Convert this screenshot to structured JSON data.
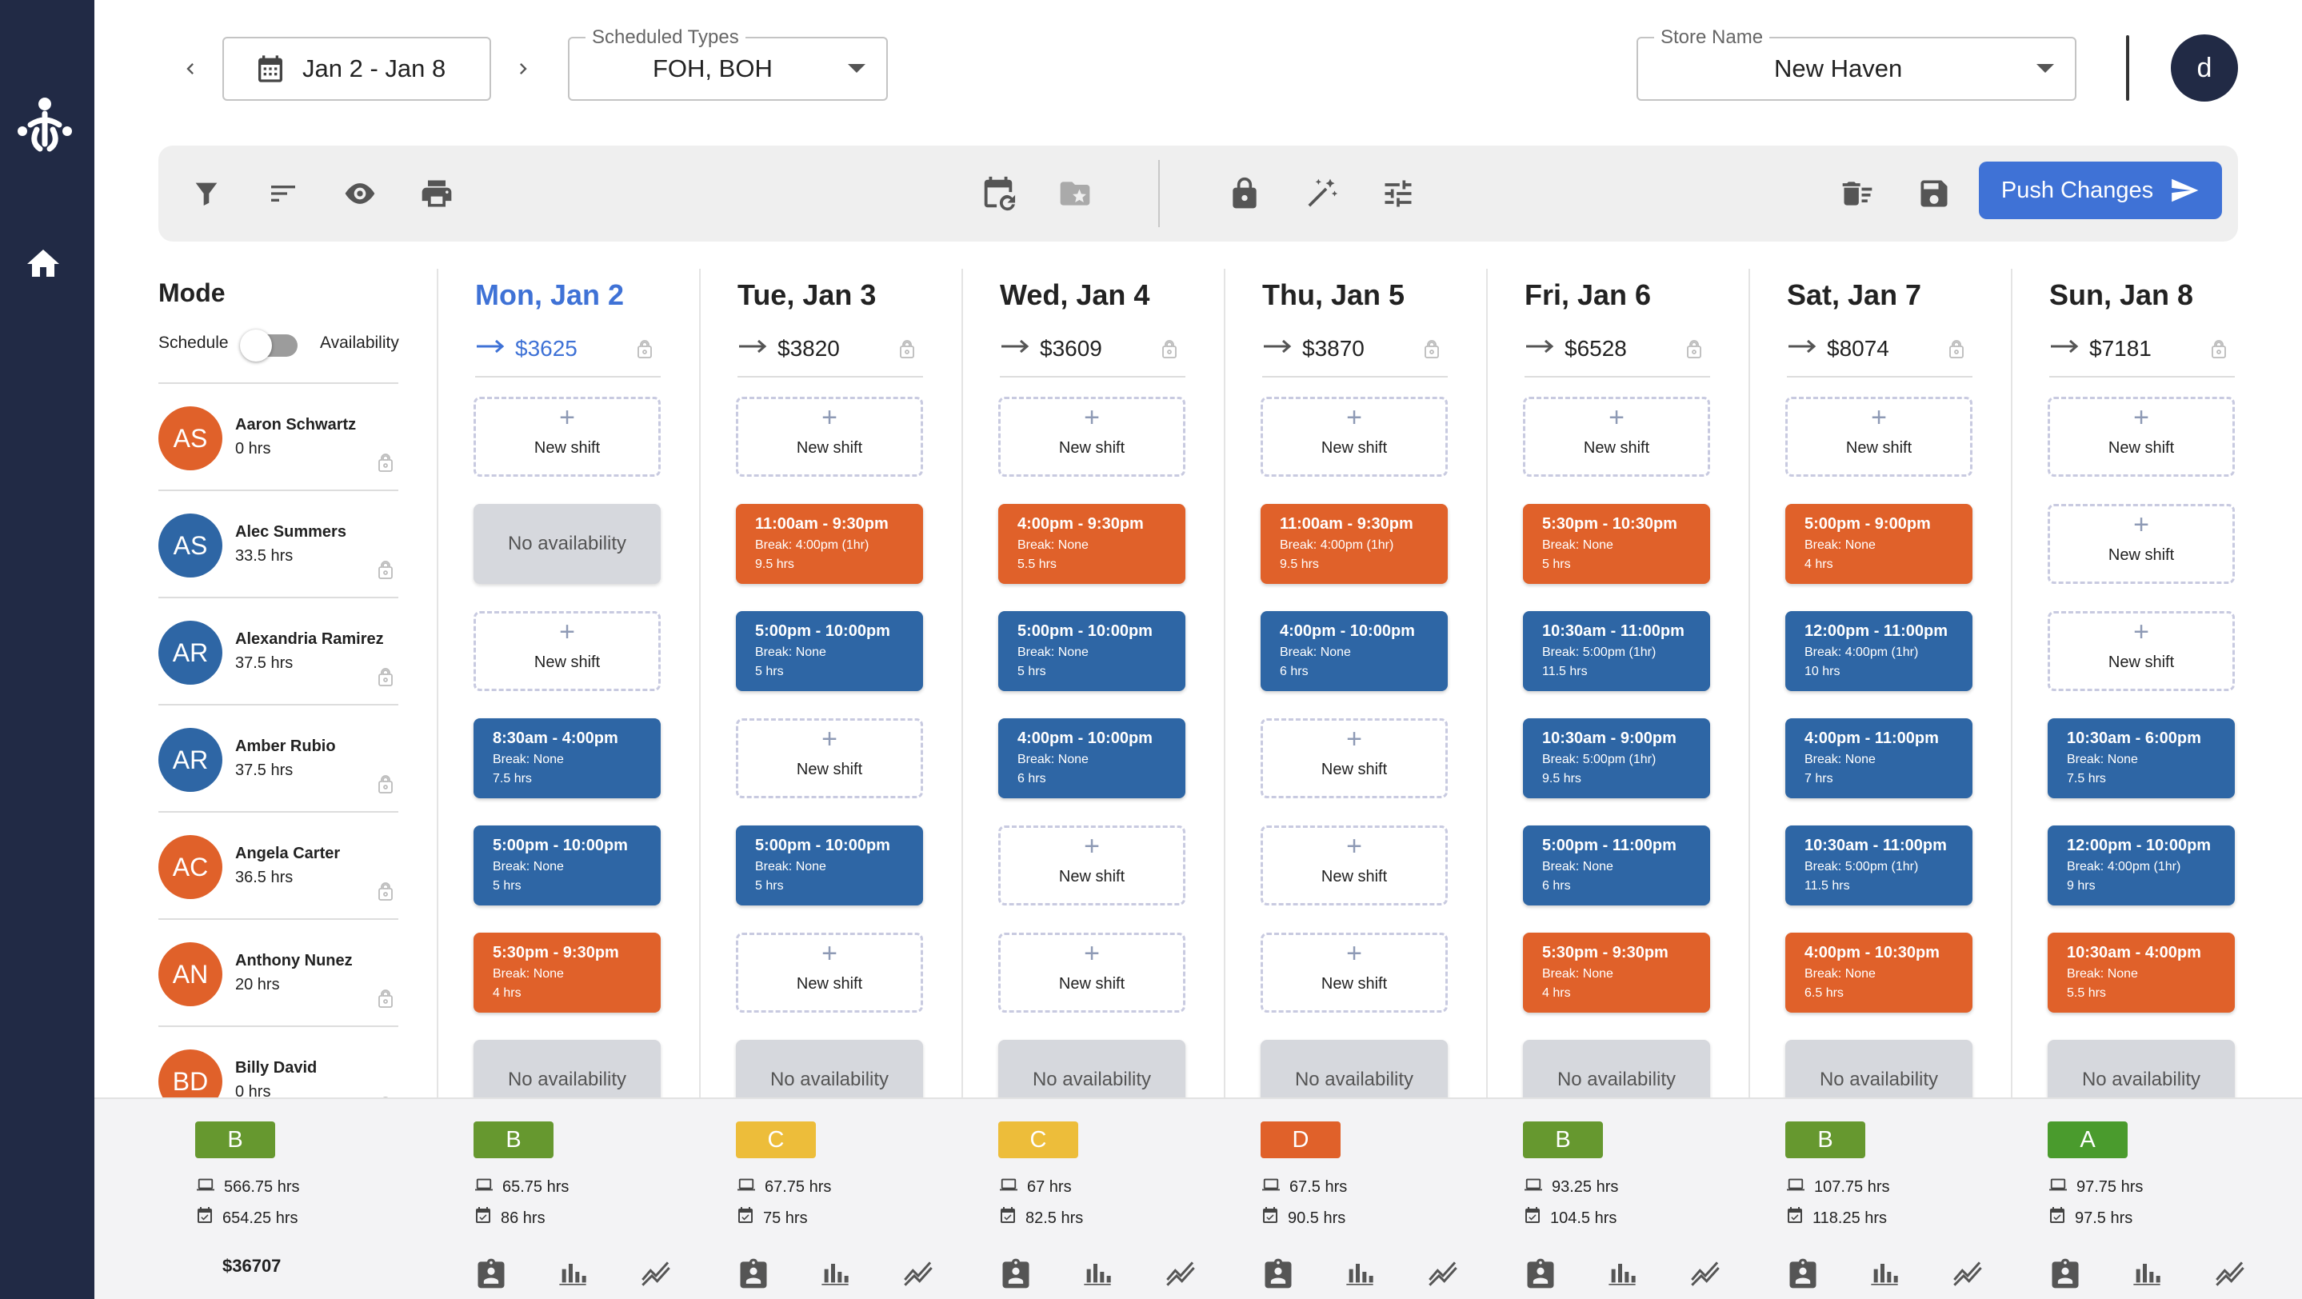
{
  "header": {
    "date_range": "Jan 2 - Jan 8",
    "types_label": "Scheduled Types",
    "types_value": "FOH, BOH",
    "store_label": "Store Name",
    "store_value": "New Haven",
    "user_initial": "d"
  },
  "toolbar": {
    "push_label": "Push Changes"
  },
  "mode": {
    "title": "Mode",
    "left": "Schedule",
    "right": "Availability",
    "availability_on": false
  },
  "labels": {
    "new_shift": "New shift",
    "no_availability": "No availability"
  },
  "colors": {
    "blue": "#2e66a5",
    "orange": "#e0612a",
    "grade_A": "#4a9b2d",
    "grade_B": "#66982f",
    "grade_C": "#edbd3a",
    "grade_D": "#e0612a",
    "accent": "#3f72d6",
    "sidebar": "#212a45"
  },
  "employees": [
    {
      "initials": "AS",
      "name": "Aaron Schwartz",
      "hours": "0 hrs",
      "color": "orange"
    },
    {
      "initials": "AS",
      "name": "Alec Summers",
      "hours": "33.5 hrs",
      "color": "blue"
    },
    {
      "initials": "AR",
      "name": "Alexandria Ramirez",
      "hours": "37.5 hrs",
      "color": "blue"
    },
    {
      "initials": "AR",
      "name": "Amber Rubio",
      "hours": "37.5 hrs",
      "color": "blue"
    },
    {
      "initials": "AC",
      "name": "Angela Carter",
      "hours": "36.5 hrs",
      "color": "orange"
    },
    {
      "initials": "AN",
      "name": "Anthony Nunez",
      "hours": "20 hrs",
      "color": "orange"
    },
    {
      "initials": "BD",
      "name": "Billy David",
      "hours": "0 hrs",
      "color": "orange"
    }
  ],
  "days": [
    {
      "label": "Mon, Jan 2",
      "revenue": "$3625",
      "today": true,
      "cells": [
        {
          "type": "new"
        },
        {
          "type": "na"
        },
        {
          "type": "new"
        },
        {
          "type": "shift",
          "color": "blue",
          "time": "8:30am - 4:00pm",
          "break": "Break: None",
          "hrs": "7.5 hrs"
        },
        {
          "type": "shift",
          "color": "blue",
          "time": "5:00pm - 10:00pm",
          "break": "Break: None",
          "hrs": "5 hrs"
        },
        {
          "type": "shift",
          "color": "orange",
          "time": "5:30pm - 9:30pm",
          "break": "Break: None",
          "hrs": "4 hrs"
        },
        {
          "type": "na"
        }
      ],
      "grade": "B",
      "scheduled": "65.75 hrs",
      "target": "86 hrs"
    },
    {
      "label": "Tue, Jan 3",
      "revenue": "$3820",
      "cells": [
        {
          "type": "new"
        },
        {
          "type": "shift",
          "color": "orange",
          "time": "11:00am - 9:30pm",
          "break": "Break: 4:00pm (1hr)",
          "hrs": "9.5 hrs"
        },
        {
          "type": "shift",
          "color": "blue",
          "time": "5:00pm - 10:00pm",
          "break": "Break: None",
          "hrs": "5 hrs"
        },
        {
          "type": "new"
        },
        {
          "type": "shift",
          "color": "blue",
          "time": "5:00pm - 10:00pm",
          "break": "Break: None",
          "hrs": "5 hrs"
        },
        {
          "type": "new"
        },
        {
          "type": "na"
        }
      ],
      "grade": "C",
      "scheduled": "67.75 hrs",
      "target": "75 hrs"
    },
    {
      "label": "Wed, Jan 4",
      "revenue": "$3609",
      "cells": [
        {
          "type": "new"
        },
        {
          "type": "shift",
          "color": "orange",
          "time": "4:00pm - 9:30pm",
          "break": "Break: None",
          "hrs": "5.5 hrs"
        },
        {
          "type": "shift",
          "color": "blue",
          "time": "5:00pm - 10:00pm",
          "break": "Break: None",
          "hrs": "5 hrs"
        },
        {
          "type": "shift",
          "color": "blue",
          "time": "4:00pm - 10:00pm",
          "break": "Break: None",
          "hrs": "6 hrs"
        },
        {
          "type": "new"
        },
        {
          "type": "new"
        },
        {
          "type": "na"
        }
      ],
      "grade": "C",
      "scheduled": "67 hrs",
      "target": "82.5 hrs"
    },
    {
      "label": "Thu, Jan 5",
      "revenue": "$3870",
      "cells": [
        {
          "type": "new"
        },
        {
          "type": "shift",
          "color": "orange",
          "time": "11:00am - 9:30pm",
          "break": "Break: 4:00pm (1hr)",
          "hrs": "9.5 hrs"
        },
        {
          "type": "shift",
          "color": "blue",
          "time": "4:00pm - 10:00pm",
          "break": "Break: None",
          "hrs": "6 hrs"
        },
        {
          "type": "new"
        },
        {
          "type": "new"
        },
        {
          "type": "new"
        },
        {
          "type": "na"
        }
      ],
      "grade": "D",
      "scheduled": "67.5 hrs",
      "target": "90.5 hrs"
    },
    {
      "label": "Fri, Jan 6",
      "revenue": "$6528",
      "cells": [
        {
          "type": "new"
        },
        {
          "type": "shift",
          "color": "orange",
          "time": "5:30pm - 10:30pm",
          "break": "Break: None",
          "hrs": "5 hrs"
        },
        {
          "type": "shift",
          "color": "blue",
          "time": "10:30am - 11:00pm",
          "break": "Break: 5:00pm (1hr)",
          "hrs": "11.5 hrs"
        },
        {
          "type": "shift",
          "color": "blue",
          "time": "10:30am - 9:00pm",
          "break": "Break: 5:00pm (1hr)",
          "hrs": "9.5 hrs"
        },
        {
          "type": "shift",
          "color": "blue",
          "time": "5:00pm - 11:00pm",
          "break": "Break: None",
          "hrs": "6 hrs"
        },
        {
          "type": "shift",
          "color": "orange",
          "time": "5:30pm - 9:30pm",
          "break": "Break: None",
          "hrs": "4 hrs"
        },
        {
          "type": "na"
        }
      ],
      "grade": "B",
      "scheduled": "93.25 hrs",
      "target": "104.5 hrs"
    },
    {
      "label": "Sat, Jan 7",
      "revenue": "$8074",
      "cells": [
        {
          "type": "new"
        },
        {
          "type": "shift",
          "color": "orange",
          "time": "5:00pm - 9:00pm",
          "break": "Break: None",
          "hrs": "4 hrs"
        },
        {
          "type": "shift",
          "color": "blue",
          "time": "12:00pm - 11:00pm",
          "break": "Break: 4:00pm (1hr)",
          "hrs": "10 hrs"
        },
        {
          "type": "shift",
          "color": "blue",
          "time": "4:00pm - 11:00pm",
          "break": "Break: None",
          "hrs": "7 hrs"
        },
        {
          "type": "shift",
          "color": "blue",
          "time": "10:30am - 11:00pm",
          "break": "Break: 5:00pm (1hr)",
          "hrs": "11.5 hrs"
        },
        {
          "type": "shift",
          "color": "orange",
          "time": "4:00pm - 10:30pm",
          "break": "Break: None",
          "hrs": "6.5 hrs"
        },
        {
          "type": "na"
        }
      ],
      "grade": "B",
      "scheduled": "107.75 hrs",
      "target": "118.25 hrs"
    },
    {
      "label": "Sun, Jan 8",
      "revenue": "$7181",
      "cells": [
        {
          "type": "new"
        },
        {
          "type": "new"
        },
        {
          "type": "new"
        },
        {
          "type": "shift",
          "color": "blue",
          "time": "10:30am - 6:00pm",
          "break": "Break: None",
          "hrs": "7.5 hrs"
        },
        {
          "type": "shift",
          "color": "blue",
          "time": "12:00pm - 10:00pm",
          "break": "Break: 4:00pm (1hr)",
          "hrs": "9 hrs"
        },
        {
          "type": "shift",
          "color": "orange",
          "time": "10:30am - 4:00pm",
          "break": "Break: None",
          "hrs": "5.5 hrs"
        },
        {
          "type": "na"
        }
      ],
      "grade": "A",
      "scheduled": "97.75 hrs",
      "target": "97.5 hrs"
    }
  ],
  "summary": {
    "grade": "B",
    "scheduled": "566.75 hrs",
    "target": "654.25 hrs",
    "total": "$36707"
  },
  "icons": [
    "filter-icon",
    "sort-icon",
    "eye-icon",
    "print-icon",
    "calendar-refresh-icon",
    "folder-star-icon",
    "lock-icon",
    "magic-wand-icon",
    "sliders-icon",
    "delete-sweep-icon",
    "save-icon",
    "send-icon",
    "home-icon",
    "badge-icon",
    "bar-chart-icon",
    "trend-icon",
    "laptop-icon",
    "calendar-check-icon"
  ]
}
